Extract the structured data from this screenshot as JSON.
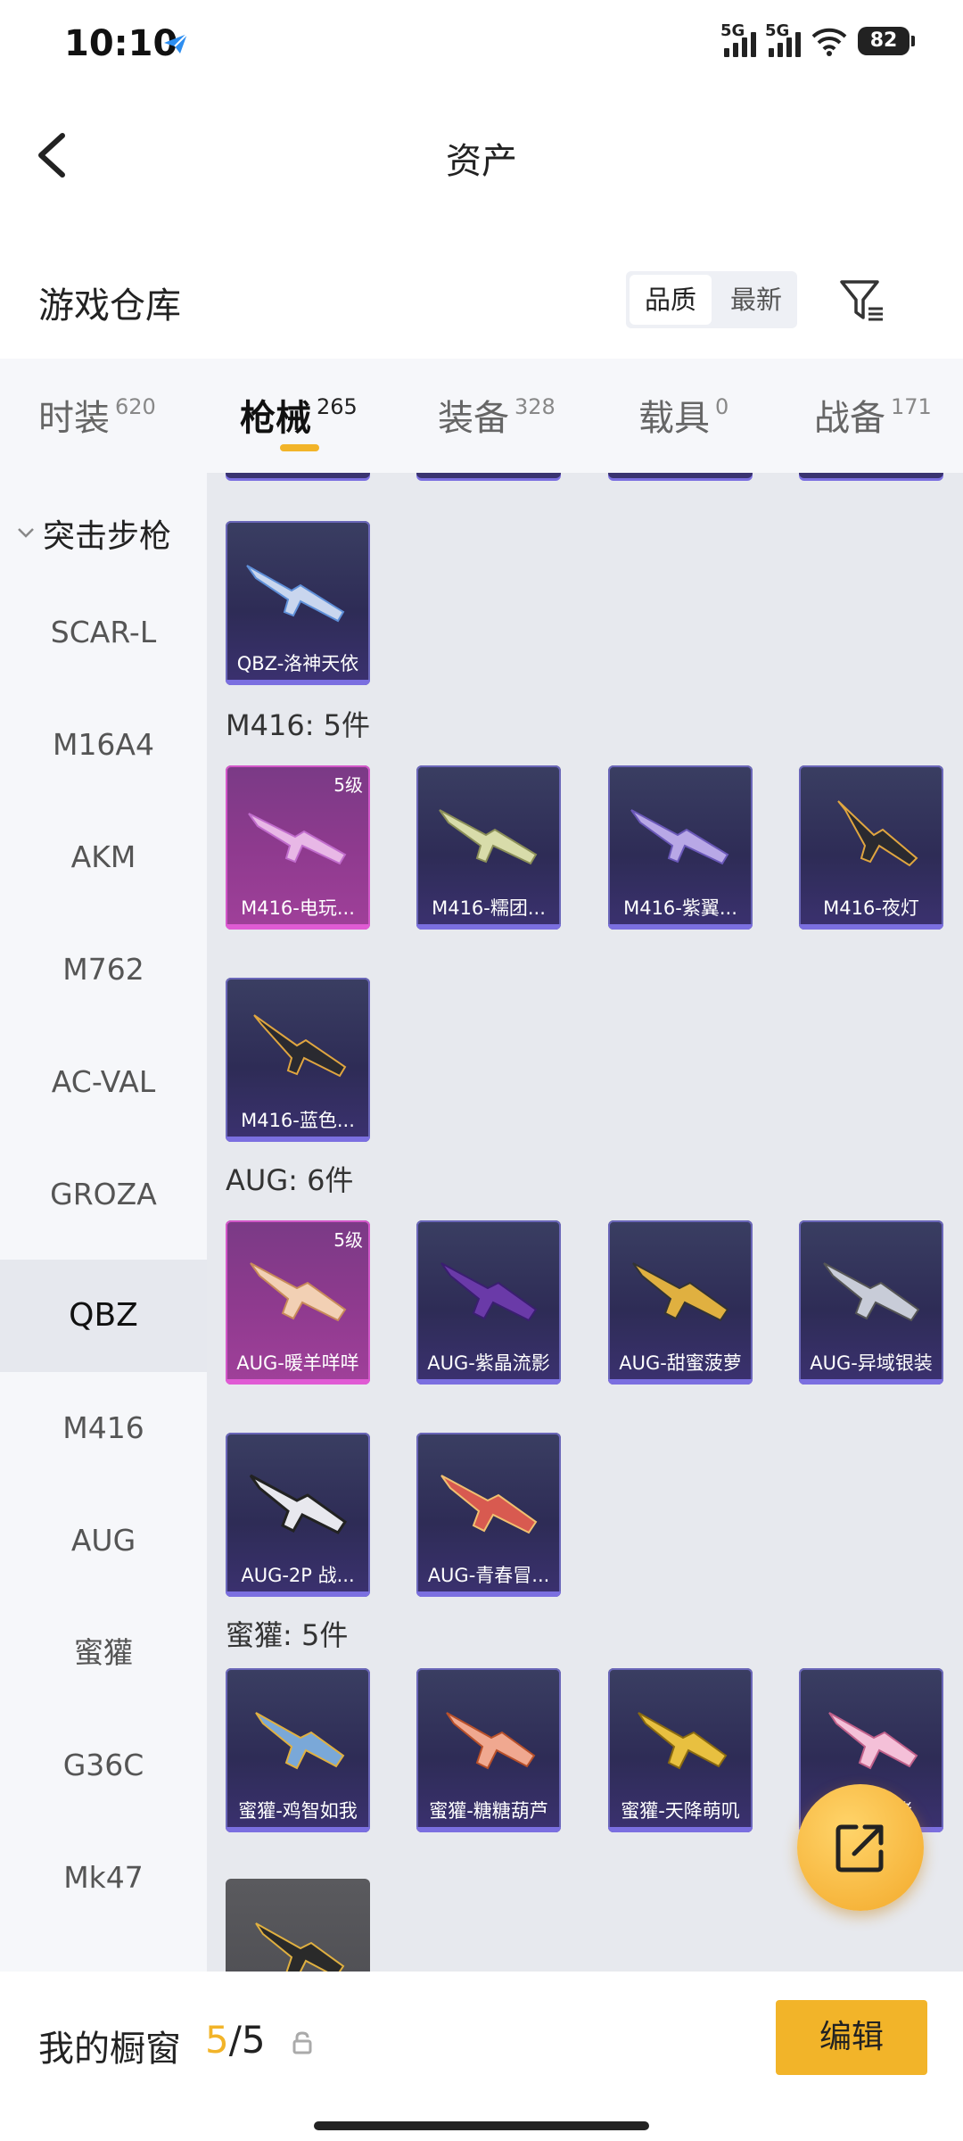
{
  "status_bar": {
    "time": "10:10",
    "signal_1": "5G",
    "signal_2": "5G",
    "battery": "82"
  },
  "header": {
    "title": "资产"
  },
  "section": {
    "title": "游戏仓库",
    "sort_quality": "品质",
    "sort_newest": "最新"
  },
  "tabs": [
    {
      "label": "时装",
      "count": "620"
    },
    {
      "label": "枪械",
      "count": "265"
    },
    {
      "label": "装备",
      "count": "328"
    },
    {
      "label": "载具",
      "count": "0"
    },
    {
      "label": "战备",
      "count": "171"
    }
  ],
  "sidebar": {
    "group": "突击步枪",
    "items": [
      "SCAR-L",
      "M16A4",
      "AKM",
      "M762",
      "AC-VAL",
      "GROZA",
      "QBZ",
      "M416",
      "AUG",
      "蜜獾",
      "G36C",
      "Mk47"
    ],
    "selected": "QBZ"
  },
  "groups": [
    {
      "header": "",
      "items": [
        {
          "name": "QBZ-洛神天依",
          "badge": ""
        }
      ]
    },
    {
      "header": "M416: 5件",
      "items": [
        {
          "name": "M416-电玩...",
          "badge": "5级"
        },
        {
          "name": "M416-糯团...",
          "badge": ""
        },
        {
          "name": "M416-紫翼...",
          "badge": ""
        },
        {
          "name": "M416-夜灯",
          "badge": ""
        },
        {
          "name": "M416-蓝色...",
          "badge": ""
        }
      ]
    },
    {
      "header": "AUG: 6件",
      "items": [
        {
          "name": "AUG-暖羊咩咩",
          "badge": "5级"
        },
        {
          "name": "AUG-紫晶流影",
          "badge": ""
        },
        {
          "name": "AUG-甜蜜菠萝",
          "badge": ""
        },
        {
          "name": "AUG-异域银装",
          "badge": ""
        },
        {
          "name": "AUG-2P 战...",
          "badge": ""
        },
        {
          "name": "AUG-青春冒...",
          "badge": ""
        }
      ]
    },
    {
      "header": "蜜獾: 5件",
      "items": [
        {
          "name": "蜜獾-鸡智如我",
          "badge": ""
        },
        {
          "name": "蜜獾-糖糖葫芦",
          "badge": ""
        },
        {
          "name": "蜜獾-天降萌叽",
          "badge": ""
        },
        {
          "name": "蜜獾-…猪",
          "badge": ""
        }
      ]
    }
  ],
  "bottom": {
    "label": "我的橱窗",
    "current": "5",
    "total": "/5",
    "edit": "编辑"
  },
  "colors": {
    "accent": "#f2b429",
    "card_purple": "#2e2c56",
    "card_pink": "#8e3a8e"
  },
  "icons": [
    "back-arrow-icon",
    "filter-icon",
    "chevron-down-icon",
    "share-external-icon",
    "lock-icon",
    "paper-plane-icon",
    "wifi-icon"
  ]
}
